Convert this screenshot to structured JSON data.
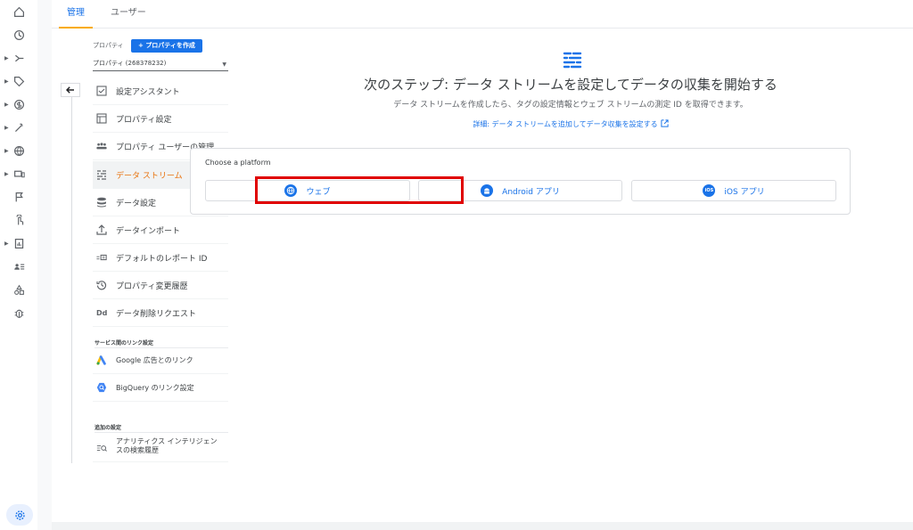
{
  "tabs": [
    {
      "label": "管理"
    },
    {
      "label": "ユーザー"
    }
  ],
  "property": {
    "label": "プロパティ",
    "create_button": "+ プロパティを作成",
    "selected": "プロパティ (268378232)"
  },
  "nav": [
    {
      "label": "設定アシスタント",
      "icon": "checkbox-icon"
    },
    {
      "label": "プロパティ設定",
      "icon": "window-icon"
    },
    {
      "label": "プロパティ ユーザーの管理",
      "icon": "people-icon"
    },
    {
      "label": "データ ストリーム",
      "icon": "streams-icon",
      "active": true
    },
    {
      "label": "データ設定",
      "icon": "database-icon"
    },
    {
      "label": "データインポート",
      "icon": "upload-icon"
    },
    {
      "label": "デフォルトのレポート ID",
      "icon": "report-id-icon"
    },
    {
      "label": "プロパティ変更履歴",
      "icon": "history-icon"
    },
    {
      "label": "データ削除リクエスト",
      "icon": "dd-icon"
    }
  ],
  "sections": {
    "links_title": "サービス間のリンク設定",
    "links": [
      {
        "label": "Google 広告とのリンク",
        "icon": "google-ads-icon"
      },
      {
        "label": "BigQuery のリンク設定",
        "icon": "bigquery-icon"
      }
    ],
    "extra_title": "追加の設定",
    "extra": [
      {
        "label": "アナリティクス インテリジェンスの検索履歴",
        "icon": "search-history-icon"
      }
    ]
  },
  "main": {
    "title": "次のステップ: データ ストリームを設定してデータの収集を開始する",
    "subtitle": "データ ストリームを作成したら、タグの設定情報とウェブ ストリームの測定 ID を取得できます。",
    "link": "詳細: データ ストリームを追加してデータ収集を設定する"
  },
  "platform": {
    "title": "Choose a platform",
    "buttons": [
      {
        "label": "ウェブ",
        "icon": "globe-icon"
      },
      {
        "label": "Android アプリ",
        "icon": "android-icon"
      },
      {
        "label": "iOS アプリ",
        "icon": "ios-icon"
      }
    ]
  },
  "colors": {
    "accent": "#1a73e8",
    "active_nav": "#e8710a",
    "tab_underline": "#f9ab00",
    "highlight": "#e00000"
  }
}
